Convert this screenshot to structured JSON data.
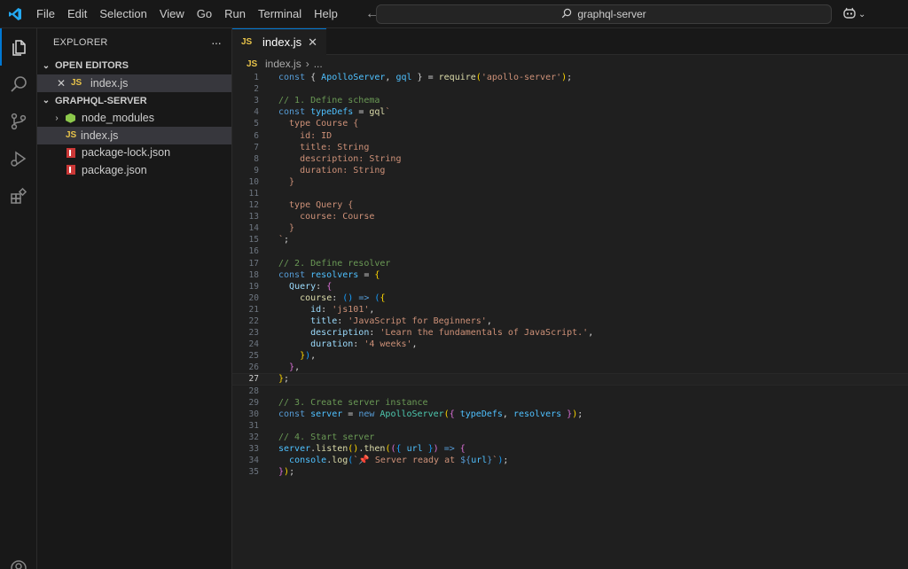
{
  "menu": [
    "File",
    "Edit",
    "Selection",
    "View",
    "Go",
    "Run",
    "Terminal",
    "Help"
  ],
  "search": {
    "label": "graphql-server"
  },
  "explorer": {
    "title": "EXPLORER",
    "more": "···",
    "open_editors": {
      "label": "OPEN EDITORS",
      "items": [
        {
          "badge": "JS",
          "name": "index.js"
        }
      ]
    },
    "project": {
      "label": "GRAPHQL-SERVER",
      "items": [
        {
          "type": "folder",
          "name": "node_modules"
        },
        {
          "type": "js",
          "badge": "JS",
          "name": "index.js"
        },
        {
          "type": "npm",
          "name": "package-lock.json"
        },
        {
          "type": "npm",
          "name": "package.json"
        }
      ]
    }
  },
  "editor": {
    "tab": {
      "badge": "JS",
      "label": "index.js",
      "close": "✕"
    },
    "breadcrumb": {
      "badge": "JS",
      "file": "index.js",
      "sep": "›",
      "rest": "..."
    },
    "current_line": 27,
    "lines": [
      [
        [
          "kw",
          "const "
        ],
        [
          "op",
          "{ "
        ],
        [
          "var",
          "ApolloServer"
        ],
        [
          "op",
          ", "
        ],
        [
          "var",
          "gql"
        ],
        [
          "op",
          " } = "
        ],
        [
          "fn",
          "require"
        ],
        [
          "b1",
          "("
        ],
        [
          "str",
          "'apollo-server'"
        ],
        [
          "b1",
          ")"
        ],
        [
          "op",
          ";"
        ]
      ],
      [],
      [
        [
          "cm",
          "// 1. Define schema"
        ]
      ],
      [
        [
          "kw",
          "const "
        ],
        [
          "var",
          "typeDefs"
        ],
        [
          "op",
          " = "
        ],
        [
          "fn",
          "gql"
        ],
        [
          "str",
          "`"
        ]
      ],
      [
        [
          "str",
          "  type Course {"
        ]
      ],
      [
        [
          "str",
          "    id: ID"
        ]
      ],
      [
        [
          "str",
          "    title: String"
        ]
      ],
      [
        [
          "str",
          "    description: String"
        ]
      ],
      [
        [
          "str",
          "    duration: String"
        ]
      ],
      [
        [
          "str",
          "  }"
        ]
      ],
      [],
      [
        [
          "str",
          "  type Query {"
        ]
      ],
      [
        [
          "str",
          "    course: Course"
        ]
      ],
      [
        [
          "str",
          "  }"
        ]
      ],
      [
        [
          "str",
          "`"
        ],
        [
          "op",
          ";"
        ]
      ],
      [],
      [
        [
          "cm",
          "// 2. Define resolver"
        ]
      ],
      [
        [
          "kw",
          "const "
        ],
        [
          "var",
          "resolvers"
        ],
        [
          "op",
          " = "
        ],
        [
          "b1",
          "{"
        ]
      ],
      [
        [
          "op",
          "  "
        ],
        [
          "prop",
          "Query"
        ],
        [
          "op",
          ": "
        ],
        [
          "b2",
          "{"
        ]
      ],
      [
        [
          "op",
          "    "
        ],
        [
          "fn",
          "course"
        ],
        [
          "op",
          ": "
        ],
        [
          "b3",
          "()"
        ],
        [
          "kw",
          " => "
        ],
        [
          "b3",
          "("
        ],
        [
          "b1",
          "{"
        ]
      ],
      [
        [
          "op",
          "      "
        ],
        [
          "prop",
          "id"
        ],
        [
          "op",
          ": "
        ],
        [
          "str",
          "'js101'"
        ],
        [
          "op",
          ","
        ]
      ],
      [
        [
          "op",
          "      "
        ],
        [
          "prop",
          "title"
        ],
        [
          "op",
          ": "
        ],
        [
          "str",
          "'JavaScript for Beginners'"
        ],
        [
          "op",
          ","
        ]
      ],
      [
        [
          "op",
          "      "
        ],
        [
          "prop",
          "description"
        ],
        [
          "op",
          ": "
        ],
        [
          "str",
          "'Learn the fundamentals of JavaScript.'"
        ],
        [
          "op",
          ","
        ]
      ],
      [
        [
          "op",
          "      "
        ],
        [
          "prop",
          "duration"
        ],
        [
          "op",
          ": "
        ],
        [
          "str",
          "'4 weeks'"
        ],
        [
          "op",
          ","
        ]
      ],
      [
        [
          "op",
          "    "
        ],
        [
          "b1",
          "}"
        ],
        [
          "b3",
          ")"
        ],
        [
          "op",
          ","
        ]
      ],
      [
        [
          "op",
          "  "
        ],
        [
          "b2",
          "}"
        ],
        [
          "op",
          ","
        ]
      ],
      [
        [
          "b1",
          "}"
        ],
        [
          "op",
          ";"
        ]
      ],
      [],
      [
        [
          "cm",
          "// 3. Create server instance"
        ]
      ],
      [
        [
          "kw",
          "const "
        ],
        [
          "var",
          "server"
        ],
        [
          "op",
          " = "
        ],
        [
          "kw",
          "new "
        ],
        [
          "type",
          "ApolloServer"
        ],
        [
          "b1",
          "("
        ],
        [
          "b2",
          "{ "
        ],
        [
          "var",
          "typeDefs"
        ],
        [
          "op",
          ", "
        ],
        [
          "var",
          "resolvers"
        ],
        [
          "b2",
          " }"
        ],
        [
          "b1",
          ")"
        ],
        [
          "op",
          ";"
        ]
      ],
      [],
      [
        [
          "cm",
          "// 4. Start server"
        ]
      ],
      [
        [
          "var",
          "server"
        ],
        [
          "op",
          "."
        ],
        [
          "fn",
          "listen"
        ],
        [
          "b1",
          "()"
        ],
        [
          "op",
          "."
        ],
        [
          "fn",
          "then"
        ],
        [
          "b1",
          "("
        ],
        [
          "b2",
          "("
        ],
        [
          "b3",
          "{ "
        ],
        [
          "var",
          "url"
        ],
        [
          "b3",
          " }"
        ],
        [
          "b2",
          ")"
        ],
        [
          "kw",
          " => "
        ],
        [
          "b2",
          "{"
        ]
      ],
      [
        [
          "op",
          "  "
        ],
        [
          "var",
          "console"
        ],
        [
          "op",
          "."
        ],
        [
          "fn",
          "log"
        ],
        [
          "b3",
          "("
        ],
        [
          "str",
          "`📌 Server ready at "
        ],
        [
          "kw",
          "${"
        ],
        [
          "var",
          "url"
        ],
        [
          "kw",
          "}"
        ],
        [
          "str",
          "`"
        ],
        [
          "b3",
          ")"
        ],
        [
          "op",
          ";"
        ]
      ],
      [
        [
          "b2",
          "}"
        ],
        [
          "b1",
          ")"
        ],
        [
          "op",
          ";"
        ]
      ]
    ]
  }
}
